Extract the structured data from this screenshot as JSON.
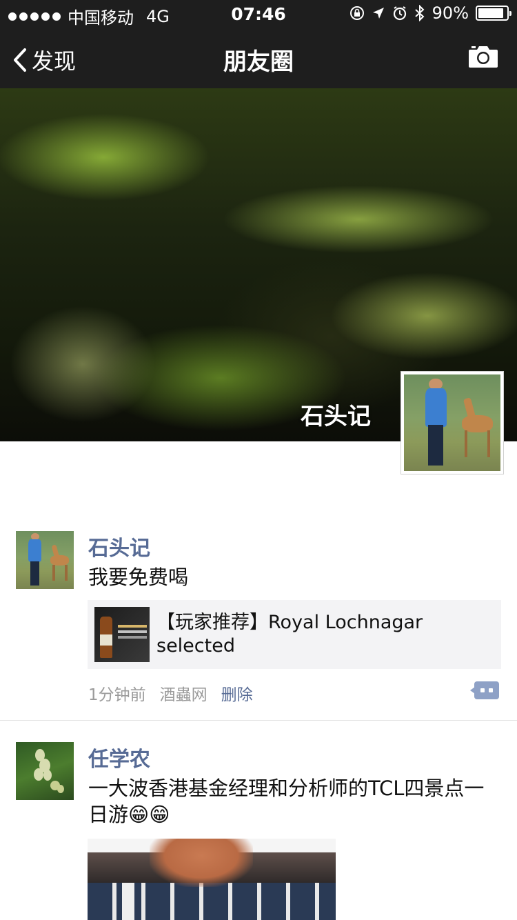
{
  "status_bar": {
    "carrier": "中国移动",
    "network": "4G",
    "time": "07:46",
    "battery": "90%",
    "battery_level": 0.9
  },
  "nav": {
    "back_label": "发现",
    "title": "朋友圈",
    "camera_icon": "camera-icon"
  },
  "cover": {
    "user_name": "石头记"
  },
  "posts": [
    {
      "name": "石头记",
      "text": "我要免费喝",
      "link": {
        "title": "【玩家推荐】Royal Lochnagar selected"
      },
      "time": "1分钟前",
      "source": "酒蟲网",
      "delete_label": "删除"
    },
    {
      "name": "任学农",
      "text": "一大波香港基金经理和分析师的TCL四景点一日游😁😁"
    }
  ],
  "colors": {
    "nav_bg": "#1e1e1e",
    "name_blue": "#576b95",
    "meta_gray": "#9b9b9b",
    "card_bg": "#f3f3f5"
  }
}
